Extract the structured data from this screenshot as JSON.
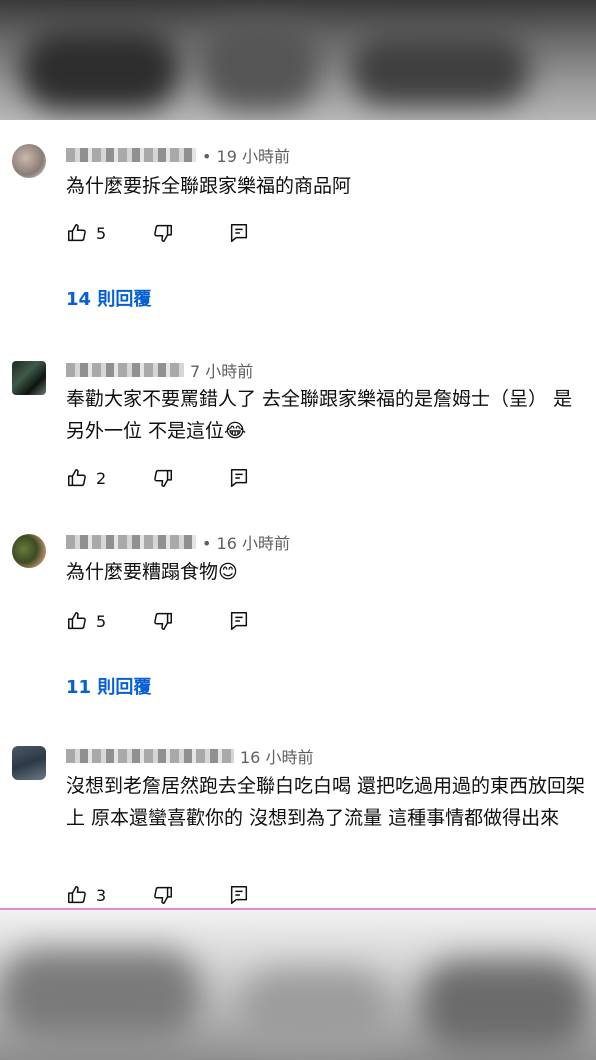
{
  "comments": [
    {
      "time": "• 19 小時前",
      "text": "為什麼要拆全聯跟家樂福的商品阿",
      "likes": "5",
      "replies": "14 則回覆"
    },
    {
      "time": "7 小時前",
      "text": "奉勸大家不要罵錯人了 去全聯跟家樂福的是詹姆士（呈） 是另外一位  不是這位😂",
      "likes": "2"
    },
    {
      "time": "• 16 小時前",
      "text": "為什麼要糟蹋食物😊",
      "likes": "5",
      "replies": "11 則回覆"
    },
    {
      "time": "16 小時前",
      "text": "沒想到老詹居然跑去全聯白吃白喝  還把吃過用過的東西放回架上  原本還蠻喜歡你的  沒想到為了流量 這種事情都做得出來",
      "likes": "3"
    }
  ],
  "icons": {
    "like": "thumbs-up-icon",
    "dislike": "thumbs-down-icon",
    "reply": "reply-comment-icon"
  },
  "colors": {
    "reply_link": "#065fd4",
    "meta_text": "#606060"
  }
}
